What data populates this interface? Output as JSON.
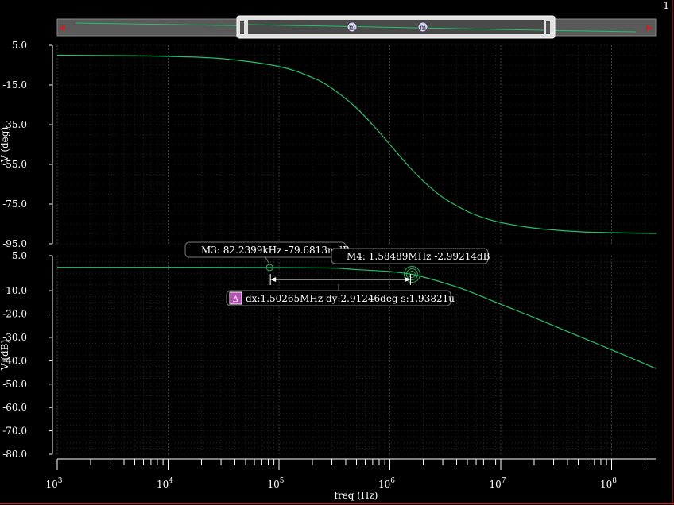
{
  "corner_label": "1",
  "colors": {
    "background": "#000000",
    "trace": "#1fc46a",
    "grid": "#3a3a3a",
    "marker": "#18b75c",
    "delta_icon": "#b44fb4"
  },
  "chart_data": [
    {
      "type": "line",
      "xscale": "log",
      "xlim": [
        1000,
        250000000
      ],
      "ylim": [
        -95,
        5
      ],
      "ylabel": "V (deg)",
      "ytick_labels": [
        "5.0",
        "-15.0",
        "-35.0",
        "-55.0",
        "-75.0",
        "-95.0"
      ],
      "yticks": [
        5,
        -15,
        -35,
        -55,
        -75,
        -95
      ],
      "series": [
        {
          "values_x": [
            1000,
            5000,
            10000,
            30000,
            100000,
            200000,
            300000,
            500000,
            800000,
            1000000,
            1500000,
            2000000,
            3000000,
            5000000,
            7000000,
            10000000,
            20000000,
            50000000,
            100000000,
            250000000
          ],
          "values_y": [
            0,
            -0.3,
            -0.6,
            -1.7,
            -5.7,
            -11.3,
            -16.7,
            -26.6,
            -38.7,
            -45.0,
            -56.3,
            -63.4,
            -71.6,
            -78.7,
            -81.9,
            -84.3,
            -87.1,
            -88.9,
            -89.4,
            -89.8
          ]
        }
      ]
    },
    {
      "type": "line",
      "xscale": "log",
      "xlim": [
        1000,
        250000000
      ],
      "ylim": [
        -80,
        5
      ],
      "ylabel": "V (dB)",
      "xlabel": "freq (Hz)",
      "ytick_labels": [
        "5.0",
        "-10.0",
        "-20.0",
        "-30.0",
        "-40.0",
        "-50.0",
        "-60.0",
        "-70.0",
        "-80.0"
      ],
      "yticks": [
        5,
        -10,
        -20,
        -30,
        -40,
        -50,
        -60,
        -70,
        -80
      ],
      "xtick_labels": [
        {
          "base": "10",
          "exp": "3"
        },
        {
          "base": "10",
          "exp": "4"
        },
        {
          "base": "10",
          "exp": "5"
        },
        {
          "base": "10",
          "exp": "6"
        },
        {
          "base": "10",
          "exp": "7"
        },
        {
          "base": "10",
          "exp": "8"
        }
      ],
      "xticks": [
        1000,
        10000,
        100000,
        1000000,
        10000000,
        100000000
      ],
      "series": [
        {
          "values_x": [
            1000,
            10000,
            82240,
            300000,
            500000,
            1000000,
            1584890,
            2000000,
            3000000,
            5000000,
            10000000,
            20000000,
            50000000,
            100000000,
            250000000
          ],
          "values_y": [
            0,
            0,
            -0.08,
            -0.32,
            -0.97,
            -1.8,
            -2.99,
            -4.15,
            -6.5,
            -10.0,
            -15.8,
            -21.5,
            -29.4,
            -35.3,
            -43.3
          ]
        }
      ],
      "markers": [
        {
          "label": "M3: 82.2399kHz -79.6813mdB",
          "x": 82240,
          "y": -0.08
        },
        {
          "label": "M4: 1.58489MHz -2.99214dB",
          "x": 1584890,
          "y": -2.99
        }
      ],
      "delta": {
        "icon": "Δ",
        "label": "dx:1.50265MHz dy:2.91246deg s:1.93821u"
      }
    }
  ],
  "scroller": {
    "left_arrow": "◀",
    "right_arrow": "▶",
    "handle_marks": [
      "m",
      "m"
    ]
  }
}
